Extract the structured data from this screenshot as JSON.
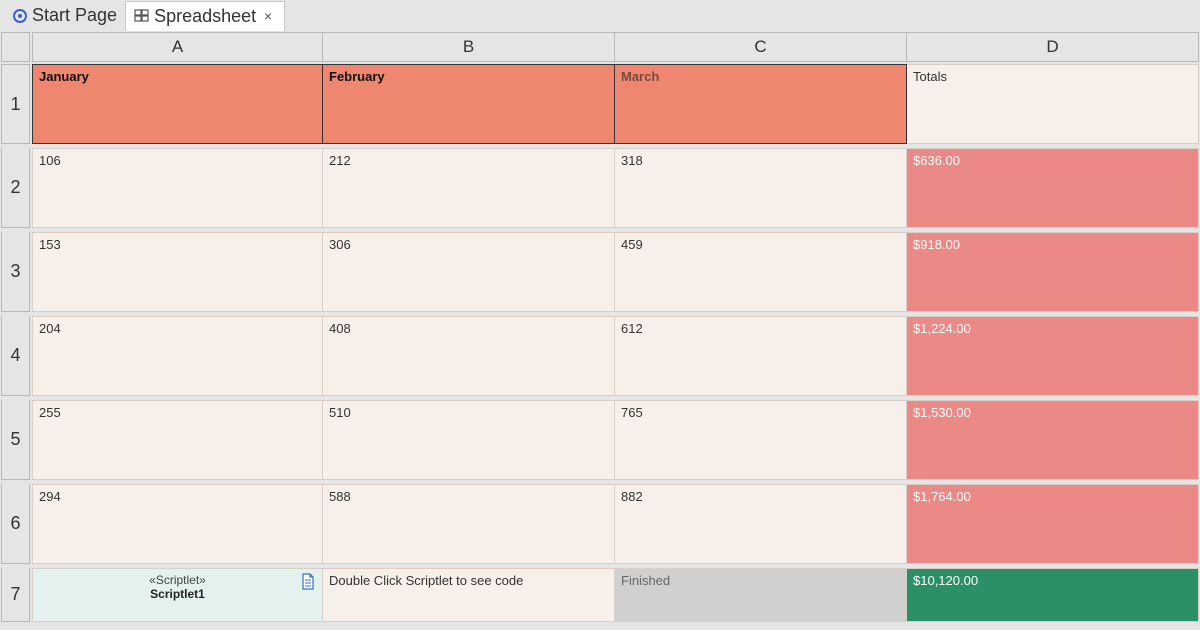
{
  "tabs": {
    "start": "Start Page",
    "spreadsheet": "Spreadsheet"
  },
  "columns": [
    "A",
    "B",
    "C",
    "D"
  ],
  "rows": [
    "1",
    "2",
    "3",
    "4",
    "5",
    "6",
    "7"
  ],
  "grid": {
    "r1": {
      "A": "January",
      "B": "February",
      "C": "March",
      "D": "Totals"
    },
    "r2": {
      "A": "106",
      "B": "212",
      "C": "318",
      "D": "$636.00"
    },
    "r3": {
      "A": "153",
      "B": "306",
      "C": "459",
      "D": "$918.00"
    },
    "r4": {
      "A": "204",
      "B": "408",
      "C": "612",
      "D": "$1,224.00"
    },
    "r5": {
      "A": "255",
      "B": "510",
      "C": "765",
      "D": "$1,530.00"
    },
    "r6": {
      "A": "294",
      "B": "588",
      "C": "882",
      "D": "$1,764.00"
    },
    "r7": {
      "A_stereo": "«Scriptlet»",
      "A_name": "Scriptlet1",
      "B": "Double Click Scriptlet to see code",
      "C": "Finished",
      "D": "$10,120.00"
    }
  },
  "colors": {
    "salmon": "#ee8670",
    "cream": "#f7efe9",
    "pink": "#ea8986",
    "green": "#2b9065",
    "gray": "#d0d0d0",
    "mint": "#e3f2ee"
  }
}
